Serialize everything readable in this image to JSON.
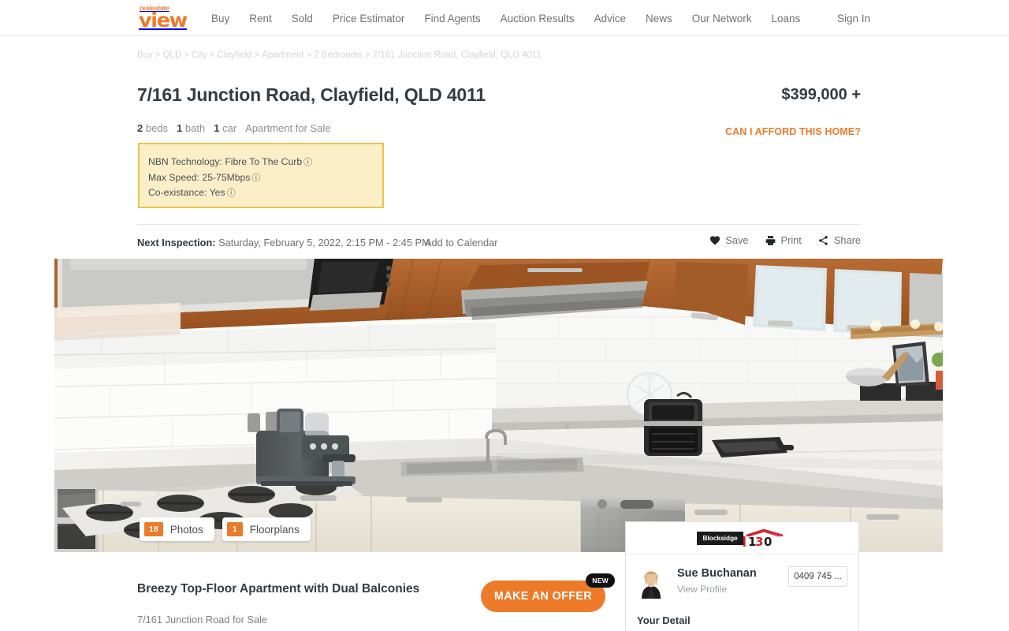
{
  "header": {
    "logo": {
      "top_text": "realestate",
      "main_text": "view"
    },
    "nav_items": [
      {
        "label": "Buy"
      },
      {
        "label": "Rent"
      },
      {
        "label": "Sold"
      },
      {
        "label": "Price Estimator"
      },
      {
        "label": "Find Agents"
      },
      {
        "label": "Auction Results"
      },
      {
        "label": "Advice"
      },
      {
        "label": "News"
      },
      {
        "label": "Our Network"
      },
      {
        "label": "Loans"
      }
    ],
    "sign_in": "Sign In"
  },
  "breadcrumb": {
    "items": [
      "Buy",
      "QLD",
      "City",
      "Clayfield",
      "Apartment",
      "2 Bedrooms",
      "7/161 Junction Road, Clayfield, QLD 4011"
    ],
    "separator": ">"
  },
  "listing": {
    "title": "7/161 Junction Road, Clayfield, QLD 4011",
    "price": "$399,000 +",
    "afford_link": "CAN I AFFORD THIS HOME?",
    "features": {
      "beds_count": "2",
      "beds_label": "beds",
      "baths_count": "1",
      "baths_label": "bath",
      "cars_count": "1",
      "cars_label": "car",
      "property_type": "Apartment for Sale"
    },
    "headline": "Breezy Top-Floor Apartment with Dual Balconies",
    "subheadline": "7/161 Junction Road for Sale"
  },
  "nbn": {
    "technology": "NBN Technology: Fibre To The Curb",
    "max_speed": "Max Speed: 25-75Mbps",
    "co_existance": "Co-existance: Yes",
    "info_glyph": "ⓘ"
  },
  "inspection": {
    "label": "Next Inspection:",
    "datetime": "Saturday, February 5, 2022, 2:15 PM - 2:45 PM",
    "add_to_calendar": "Add to Calendar"
  },
  "actions": {
    "save": "Save",
    "print": "Print",
    "share": "Share"
  },
  "gallery": {
    "photos_count": "18",
    "photos_label": "Photos",
    "floorplans_count": "1",
    "floorplans_label": "Floorplans"
  },
  "offer": {
    "button_label": "MAKE AN OFFER",
    "new_badge": "NEW"
  },
  "agent_card": {
    "agency_name": "Blocksidge",
    "agency_number": "130",
    "agent_name": "Sue Buchanan",
    "view_profile": "View Profile",
    "phone": "0409 745 ...",
    "your_detail": "Your Detail"
  },
  "colors": {
    "brand_orange": "#ED7A28",
    "nbn_bg": "#FCEFC8",
    "nbn_border": "#E8C44C",
    "text_dark": "#333B42",
    "text_muted": "#6E7276",
    "agency_red": "#D8202A"
  }
}
